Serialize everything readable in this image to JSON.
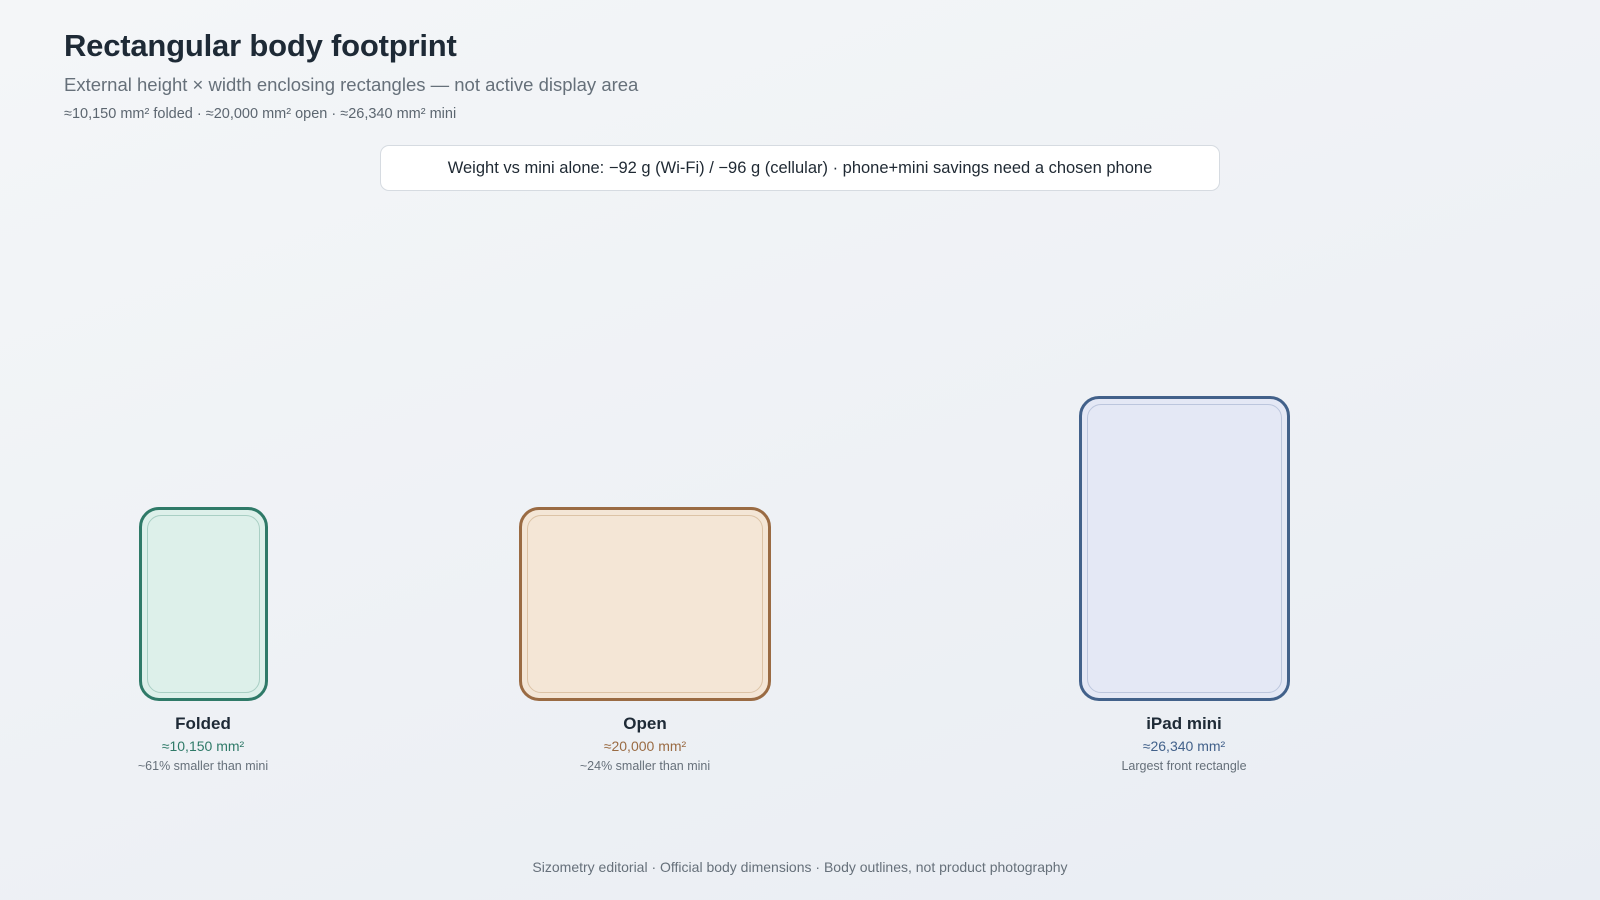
{
  "header": {
    "title": "Rectangular body footprint",
    "subtitle": "External height × width enclosing rectangles — not active display area",
    "summary": "≈10,150 mm² folded · ≈20,000 mm² open · ≈26,340 mm² mini"
  },
  "callout": {
    "text": "Weight vs mini alone: −92 g (Wi-Fi) / −96 g (cellular) · phone+mini savings need a chosen phone"
  },
  "devices": [
    {
      "name": "Folded",
      "area_mm2": 10150,
      "area_label": "≈10,150 mm²",
      "note": "~61% smaller than mini",
      "accent_color": "#2f7a68",
      "fill_color": "#ddf0ea"
    },
    {
      "name": "Open",
      "area_mm2": 20000,
      "area_label": "≈20,000 mm²",
      "note": "~24% smaller than mini",
      "accent_color": "#9a6b43",
      "fill_color": "#f4e6d6"
    },
    {
      "name": "iPad mini",
      "area_mm2": 26340,
      "area_label": "≈26,340 mm²",
      "note": "Largest front rectangle",
      "accent_color": "#42618a",
      "fill_color": "#e4e8f5"
    }
  ],
  "footer": {
    "text": "Sizometry editorial · Official body dimensions · Body outlines, not product photography"
  }
}
